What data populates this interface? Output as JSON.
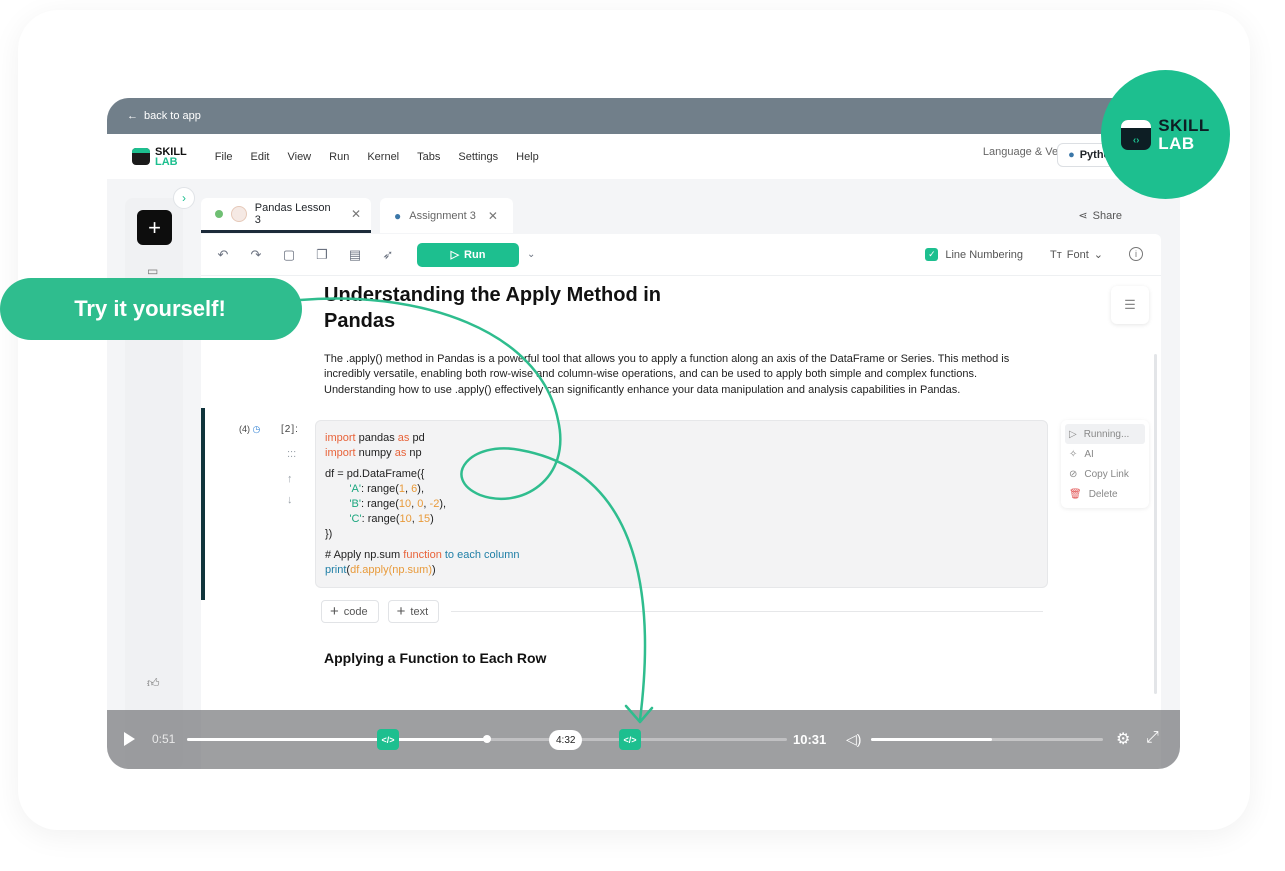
{
  "topbar": {
    "back_label": "back to app"
  },
  "menubar": {
    "logo_top": "SKILL",
    "logo_bottom": "LAB",
    "items": [
      "File",
      "Edit",
      "View",
      "Run",
      "Kernel",
      "Tabs",
      "Settings",
      "Help"
    ],
    "language_label": "Language & Version:",
    "language_value": "Python"
  },
  "tabs": [
    {
      "label": "Pandas Lesson 3",
      "close": "✕"
    },
    {
      "label": "Assignment 3",
      "close": "✕"
    }
  ],
  "share_label": "Share",
  "toolbar": {
    "run_label": "Run",
    "line_numbering_label": "Line Numbering",
    "font_label": "Font"
  },
  "doc": {
    "title": "Understanding the Apply Method in Pandas",
    "paragraph": "The .apply() method in Pandas is a powerful tool that allows you to apply a function along an axis of the DataFrame or Series. This method is incredibly versatile, enabling both row-wise and column-wise operations, and can be used to apply both simple and complex functions. Understanding how to use .apply() effectively can significantly enhance your data manipulation and analysis capabilities in Pandas.",
    "section_heading": "Applying a Function to Each Row"
  },
  "cell": {
    "exec_count": "(4)",
    "number": "[2]:",
    "drag_handle": ":::",
    "up": "↑",
    "down": "↓"
  },
  "context_menu": [
    "Running...",
    "AI",
    "Copy Link",
    "Delete"
  ],
  "add_buttons": {
    "code": "code",
    "text": "text"
  },
  "player": {
    "current_time": "0:51",
    "tooltip_time": "4:32",
    "total_time": "10:31",
    "progress": 0.5,
    "volume": 0.52,
    "marker_glyph": "</>"
  },
  "callout": {
    "label": "Try it yourself!"
  },
  "brand": {
    "top": "SKILL",
    "bottom": "LAB"
  },
  "colors": {
    "accent": "#1dbf8f",
    "topbar": "#717f8a",
    "dark": "#10343b"
  }
}
